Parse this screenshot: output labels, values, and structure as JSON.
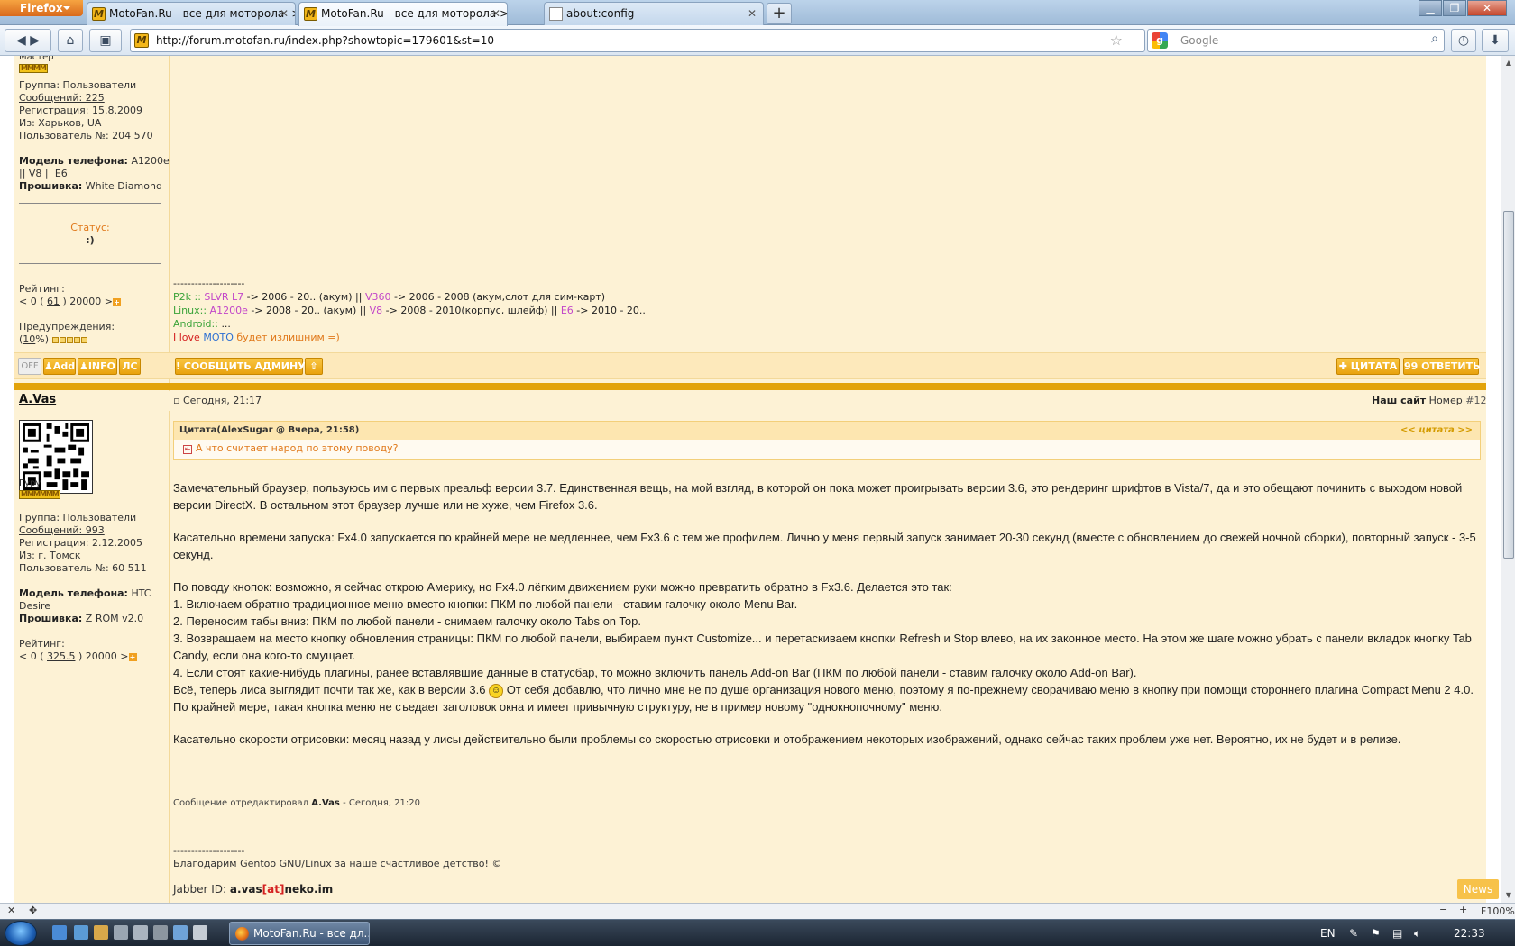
{
  "browser": {
    "menu_label": "Firefox",
    "tabs": [
      {
        "title": "MotoFan.Ru - все для моторола -> ...",
        "icon": "M"
      },
      {
        "title": "MotoFan.Ru - все для моторола > Fi...",
        "icon": "M"
      },
      {
        "title": "about:config",
        "icon": ""
      }
    ],
    "url": "http://forum.motofan.ru/index.php?showtopic=179601&st=10",
    "search_placeholder": "Google"
  },
  "post1": {
    "rank": "Мастер",
    "rank_stars": "ММММ",
    "group": "Группа: Пользователи",
    "messages": "Сообщений: 225",
    "registration": "Регистрация: 15.8.2009",
    "from": "Из: Харьков, UA",
    "user_no": "Пользователь №: 204 570",
    "phone_label": "Модель телефона:",
    "phone_value": "A1200e",
    "phone_value2": "|| V8 || E6",
    "firmware_label": "Прошивка:",
    "firmware_value": "White Diamond",
    "status_label": "Статус:",
    "status_value": ":)",
    "rating_label": "Рейтинг:",
    "rating_pre": "< 0 (",
    "rating_value": "61",
    "rating_post": ") 20000 >",
    "warn_label": "Предупреждения:",
    "warn_pre": "(",
    "warn_value": "10",
    "warn_post": "%)",
    "sig_sep": "--------------------",
    "sig_line1": [
      "P2k :: ",
      "SLVR L7",
      " -> 2006 - 20.. (акум) || ",
      "V360",
      " -> 2006 - 2008 (акум,слот для сим-карт)"
    ],
    "sig_line2": [
      "Linux:: ",
      "A1200e",
      " -> 2008 - 20.. (акум) || ",
      "V8",
      " -> 2008 - 2010(корпус, шлейф) || ",
      "E6",
      " -> 2010 - 20.."
    ],
    "sig_line3": [
      "Android:: ",
      "..."
    ],
    "sig_line4": [
      "I ",
      "love",
      " ",
      "MOTO",
      " будет излишним =)"
    ],
    "buttons": {
      "off": "OFF",
      "add": "Add",
      "info": "INFO",
      "pm": "ЛС",
      "report": "СООБЩИТЬ АДМИНУ",
      "quote": "ЦИТАТА",
      "reply": "ОТВЕТИТЬ"
    }
  },
  "post2": {
    "author": "A.Vas",
    "date": "Сегодня, 21:17",
    "our_site": "Наш сайт",
    "number_label": "Номер",
    "number_value": "#12",
    "rank": "Гуру",
    "rank_stars": "ММММММ",
    "group": "Группа: Пользователи",
    "messages": "Сообщений: 993",
    "registration": "Регистрация: 2.12.2005",
    "from": "Из: г. Томск",
    "user_no": "Пользователь №: 60 511",
    "phone_label": "Модель телефона:",
    "phone_value": "HTC",
    "phone_value2": "Desire",
    "firmware_label": "Прошивка:",
    "firmware_value": "Z ROM v2.0",
    "rating_label": "Рейтинг:",
    "rating_pre": "< 0 (",
    "rating_value": "325.5",
    "rating_post": ") 20000 >",
    "quote_header": "Цитата(AlexSugar @ Вчера, 21:58)",
    "quote_link": "<< цитата >>",
    "quote_text": "А что считает народ по этому поводу?",
    "paragraphs": [
      "Замечательный браузер, пользуюсь им с первых преальф версии 3.7. Единственная вещь, на мой взгляд, в которой он пока может проигрывать версии 3.6, это рендеринг шрифтов в Vista/7, да и это обещают починить с выходом новой версии DirectX. В остальном этот браузер лучше или не хуже, чем Firefox 3.6.",
      "Касательно времени запуска: Fx4.0 запускается по крайней мере не медленнее, чем Fx3.6 с тем же профилем. Лично у меня первый запуск занимает 20-30 секунд (вместе с обновлением до свежей ночной сборки), повторный запуск - 3-5 секунд.",
      "По поводу кнопок: возможно, я сейчас открою Америку, но Fx4.0 лёгким движением руки можно превратить обратно в Fx3.6. Делается это так:",
      "1. Включаем обратно традиционное меню вместо кнопки: ПКМ по любой панели - ставим галочку около Menu Bar.",
      "2. Переносим табы вниз: ПКМ по любой панели - снимаем галочку около Tabs on Top.",
      "3. Возвращаем на место кнопку обновления страницы: ПКМ по любой панели, выбираем пункт Customize... и перетаскиваем кнопки Refresh и Stop влево, на их законное место. На этом же шаге можно убрать с панели вкладок кнопку Tab Candy, если она кого-то смущает.",
      "4. Если стоят какие-нибудь плагины, ранее вставлявшие данные в статусбар, то можно включить панель Add-on Bar (ПКМ по любой панели - ставим галочку около Add-on Bar).",
      "Всё, теперь лиса выглядит почти так же, как в версии 3.6",
      "От себя добавлю, что лично мне не по душе организация нового меню, поэтому я по-прежнему сворачиваю меню в кнопку при помощи стороннего плагина Compact Menu 2 4.0. По крайней мере, такая кнопка меню не съедает заголовок окна и имеет привычную структуру, не в пример новому \"однокнопочному\" меню.",
      "Касательно скорости отрисовки: месяц назад у лисы действительно были проблемы со скоростью отрисовки и отображением некоторых изображений, однако сейчас таких проблем уже нет. Вероятно, их не будет и в релизе."
    ],
    "edited_pre": "Сообщение отредактировал",
    "edited_by": "A.Vas",
    "edited_post": "- Сегодня, 21:20",
    "sig_sep": "--------------------",
    "sig_text": "Благодарим Gentoo GNU/Linux за наше счастливое детство! ©",
    "jabber_label": "Jabber ID:",
    "jabber_user": "a.vas",
    "jabber_at": "[at]",
    "jabber_domain": "neko.im"
  },
  "news_button": "News",
  "statusbar": {
    "zoom": "F100%"
  },
  "taskbar": {
    "task_title": "MotoFan.Ru - все дл...",
    "lang": "EN",
    "time": "22:33"
  },
  "colors": {
    "accent": "#e2a30b",
    "post_bg": "#fdf2d5",
    "quote_text": "#e0791b"
  }
}
